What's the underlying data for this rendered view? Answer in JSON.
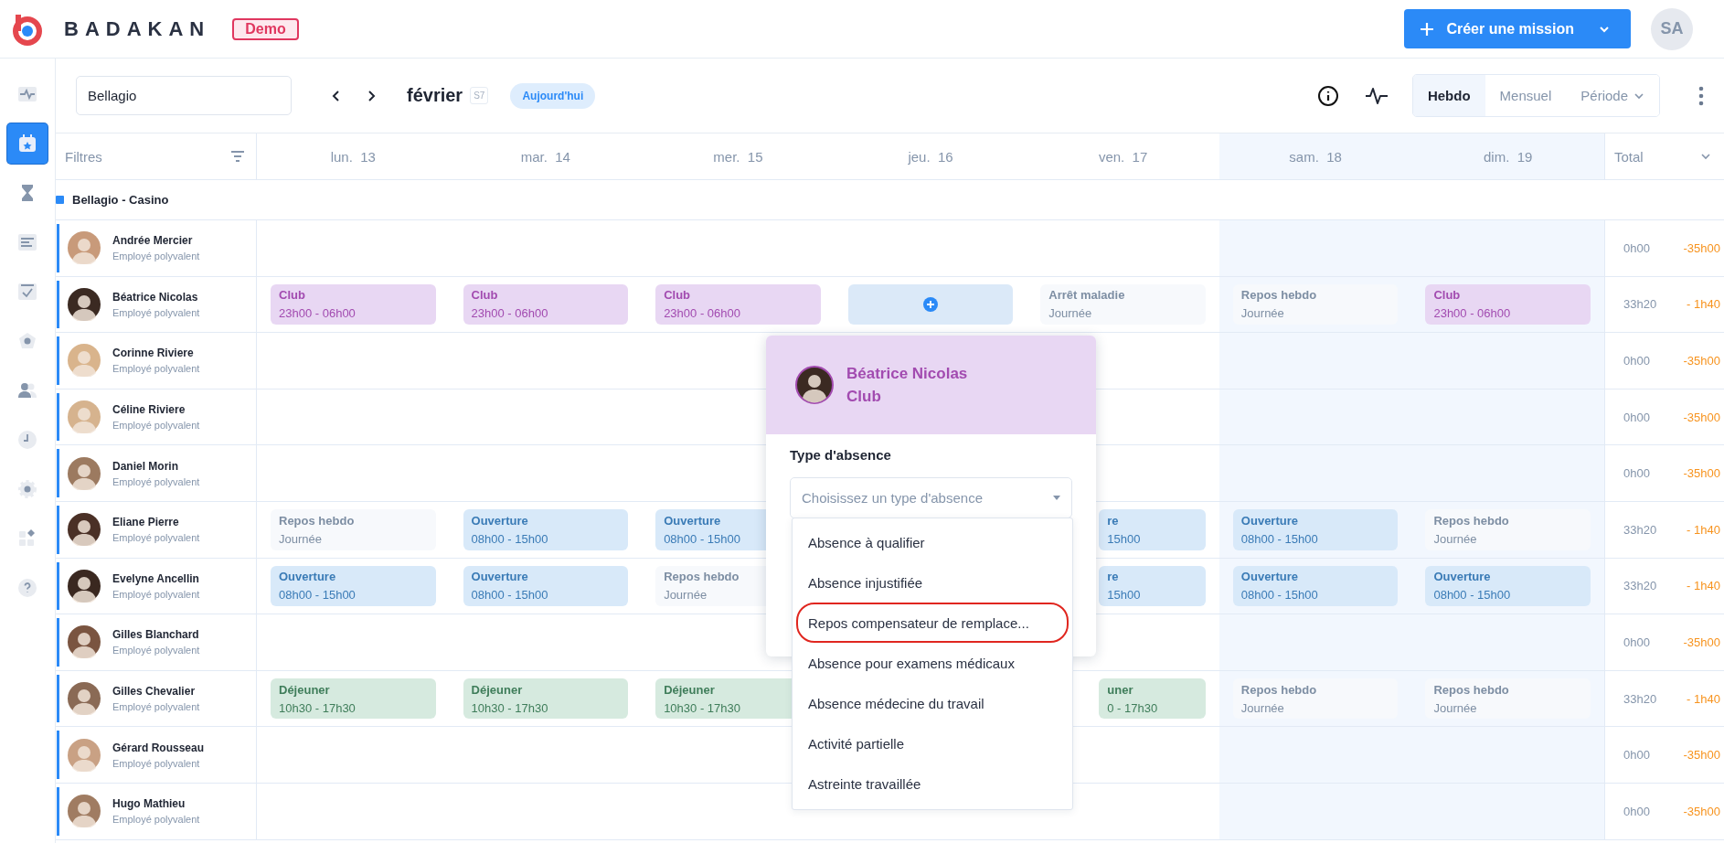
{
  "brand": {
    "name": "BADAKAN",
    "badge": "Demo"
  },
  "create_button": {
    "label": "Créer une mission"
  },
  "user": {
    "initials": "SA"
  },
  "sidebar": {
    "items": [
      {
        "selected": false
      },
      {
        "selected": true
      },
      {
        "selected": false
      },
      {
        "selected": false
      },
      {
        "selected": false
      },
      {
        "selected": false
      },
      {
        "selected": false
      },
      {
        "selected": false
      },
      {
        "selected": false
      },
      {
        "selected": false
      },
      {
        "selected": false
      }
    ]
  },
  "toolbar": {
    "site": "Bellagio",
    "month": "février",
    "week": "S7",
    "today": "Aujourd'hui",
    "views": [
      {
        "label": "Hebdo",
        "selected": true,
        "dropdown": false
      },
      {
        "label": "Mensuel",
        "selected": false,
        "dropdown": false
      },
      {
        "label": "Période",
        "selected": false,
        "dropdown": true
      }
    ]
  },
  "table": {
    "filters_label": "Filtres",
    "total_label": "Total",
    "days": [
      {
        "label": "lun.  13",
        "weekend": false
      },
      {
        "label": "mar.  14",
        "weekend": false
      },
      {
        "label": "mer.  15",
        "weekend": false
      },
      {
        "label": "jeu.  16",
        "weekend": false
      },
      {
        "label": "ven.  17",
        "weekend": false
      },
      {
        "label": "sam.  18",
        "weekend": true
      },
      {
        "label": "dim.  19",
        "weekend": true
      }
    ],
    "group": "Bellagio - Casino",
    "rows": [
      {
        "name": "Andrée Mercier",
        "role": "Employé polyvalent",
        "cells": [
          null,
          null,
          null,
          null,
          null,
          null,
          null
        ],
        "hours": "0h00",
        "balance": "-35h00"
      },
      {
        "name": "Béatrice Nicolas",
        "role": "Employé polyvalent",
        "cells": [
          {
            "kind": "club",
            "title": "Club",
            "time": "23h00 - 06h00"
          },
          {
            "kind": "club",
            "title": "Club",
            "time": "23h00 - 06h00"
          },
          {
            "kind": "club",
            "title": "Club",
            "time": "23h00 - 06h00"
          },
          {
            "kind": "add"
          },
          {
            "kind": "rest",
            "title": "Arrêt maladie",
            "time": "Journée"
          },
          {
            "kind": "rest",
            "title": "Repos hebdo",
            "time": "Journée"
          },
          {
            "kind": "club",
            "title": "Club",
            "time": "23h00 - 06h00"
          }
        ],
        "hours": "33h20",
        "balance": "- 1h40"
      },
      {
        "name": "Corinne Riviere",
        "role": "Employé polyvalent",
        "cells": [
          null,
          null,
          null,
          null,
          null,
          null,
          null
        ],
        "hours": "0h00",
        "balance": "-35h00"
      },
      {
        "name": "Céline Riviere",
        "role": "Employé polyvalent",
        "cells": [
          null,
          null,
          null,
          null,
          null,
          null,
          null
        ],
        "hours": "0h00",
        "balance": "-35h00"
      },
      {
        "name": "Daniel Morin",
        "role": "Employé polyvalent",
        "cells": [
          null,
          null,
          null,
          null,
          null,
          null,
          null
        ],
        "hours": "0h00",
        "balance": "-35h00"
      },
      {
        "name": "Eliane Pierre",
        "role": "Employé polyvalent",
        "cells": [
          {
            "kind": "rest",
            "title": "Repos hebdo",
            "time": "Journée"
          },
          {
            "kind": "opening",
            "title": "Ouverture",
            "time": "08h00 - 15h00"
          },
          {
            "kind": "opening",
            "title": "Ouverture",
            "time": "08h00 - 15h00"
          },
          null,
          {
            "kind": "opening",
            "title": "re",
            "time": "15h00",
            "covered": true
          },
          {
            "kind": "opening",
            "title": "Ouverture",
            "time": "08h00 - 15h00"
          },
          {
            "kind": "rest",
            "title": "Repos hebdo",
            "time": "Journée"
          }
        ],
        "hours": "33h20",
        "balance": "- 1h40"
      },
      {
        "name": "Evelyne Ancellin",
        "role": "Employé polyvalent",
        "cells": [
          {
            "kind": "opening",
            "title": "Ouverture",
            "time": "08h00 - 15h00"
          },
          {
            "kind": "opening",
            "title": "Ouverture",
            "time": "08h00 - 15h00"
          },
          {
            "kind": "rest",
            "title": "Repos hebdo",
            "time": "Journée"
          },
          null,
          {
            "kind": "opening",
            "title": "re",
            "time": "15h00",
            "covered": true
          },
          {
            "kind": "opening",
            "title": "Ouverture",
            "time": "08h00 - 15h00"
          },
          {
            "kind": "opening",
            "title": "Ouverture",
            "time": "08h00 - 15h00"
          }
        ],
        "hours": "33h20",
        "balance": "- 1h40"
      },
      {
        "name": "Gilles Blanchard",
        "role": "Employé polyvalent",
        "cells": [
          null,
          null,
          null,
          null,
          null,
          null,
          null
        ],
        "hours": "0h00",
        "balance": "-35h00"
      },
      {
        "name": "Gilles Chevalier",
        "role": "Employé polyvalent",
        "cells": [
          {
            "kind": "lunch",
            "title": "Déjeuner",
            "time": "10h30 - 17h30"
          },
          {
            "kind": "lunch",
            "title": "Déjeuner",
            "time": "10h30 - 17h30"
          },
          {
            "kind": "lunch",
            "title": "Déjeuner",
            "time": "10h30 - 17h30"
          },
          null,
          {
            "kind": "lunch",
            "title": "uner",
            "time": "0 - 17h30",
            "covered": true
          },
          {
            "kind": "rest",
            "title": "Repos hebdo",
            "time": "Journée"
          },
          {
            "kind": "rest",
            "title": "Repos hebdo",
            "time": "Journée"
          }
        ],
        "hours": "33h20",
        "balance": "- 1h40"
      },
      {
        "name": "Gérard Rousseau",
        "role": "Employé polyvalent",
        "cells": [
          null,
          null,
          null,
          null,
          null,
          null,
          null
        ],
        "hours": "0h00",
        "balance": "-35h00"
      },
      {
        "name": "Hugo Mathieu",
        "role": "Employé polyvalent",
        "cells": [
          null,
          null,
          null,
          null,
          null,
          null,
          null
        ],
        "hours": "0h00",
        "balance": "-35h00"
      }
    ]
  },
  "popup": {
    "name": "Béatrice Nicolas",
    "shift": "Club",
    "field_label": "Type d'absence",
    "placeholder": "Choisissez un type d'absence",
    "options": [
      {
        "label": "Absence à qualifier",
        "circled": false
      },
      {
        "label": "Absence injustifiée",
        "circled": false
      },
      {
        "label": "Repos compensateur de remplace...",
        "circled": true
      },
      {
        "label": "Absence pour examens médicaux",
        "circled": false
      },
      {
        "label": "Absence médecine du travail",
        "circled": false
      },
      {
        "label": "Activité partielle",
        "circled": false
      },
      {
        "label": "Astreinte travaillée",
        "circled": false
      }
    ]
  }
}
